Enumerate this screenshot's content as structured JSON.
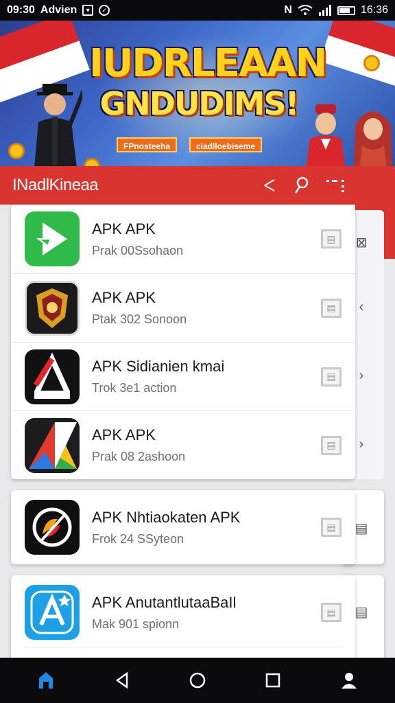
{
  "status_bar": {
    "time_left": "09:30",
    "carrier": "Advien",
    "time_right": "16:36",
    "icons": [
      "notification-box-icon",
      "shield-icon",
      "n-icon",
      "wifi-icon",
      "signal-icon",
      "battery-icon"
    ],
    "battery_level": 0.7
  },
  "banner": {
    "title": "IUDRLEAAN",
    "subtitle": "GNDUDIMS!",
    "ribbon_1": "FPnosteeha",
    "ribbon_2": "ciadlloebiseme"
  },
  "app_bar": {
    "title": "INadlKineaa",
    "share_icon": "share-icon",
    "search_icon": "search-icon",
    "more_icon": "more-icon"
  },
  "apps": [
    {
      "name": "APK APK",
      "subtitle": "Prak 00Ssohaon",
      "icon": "play-arrow-icon",
      "color": "#2fba4a"
    },
    {
      "name": "APK APK",
      "subtitle": "Ptak 302 Sonoon",
      "icon": "emblem-icon",
      "color": "#1a1a1a"
    },
    {
      "name": "APK Sidianien kmai",
      "subtitle": "Trok 3e1 action",
      "icon": "a-logo-icon",
      "color": "#111111"
    },
    {
      "name": "APK APK",
      "subtitle": "Prak 08 2ashoon",
      "icon": "triangle-logo-icon",
      "color": "#1d1d1f"
    },
    {
      "name": "APK Nhtiaokaten APK",
      "subtitle": "Frok 24 SSyteon",
      "icon": "circle-logo-icon",
      "color": "#0f0f10"
    },
    {
      "name": "APK AnutantlutaaBaIl",
      "subtitle": "Mak 901 spionn",
      "icon": "a-star-icon",
      "color": "#1ea0e6"
    }
  ],
  "colors": {
    "accent": "#d9342f",
    "nav_active": "#1e88e5"
  },
  "nav": [
    "home-icon",
    "back-icon",
    "circle-home-icon",
    "recents-icon",
    "profile-icon"
  ]
}
